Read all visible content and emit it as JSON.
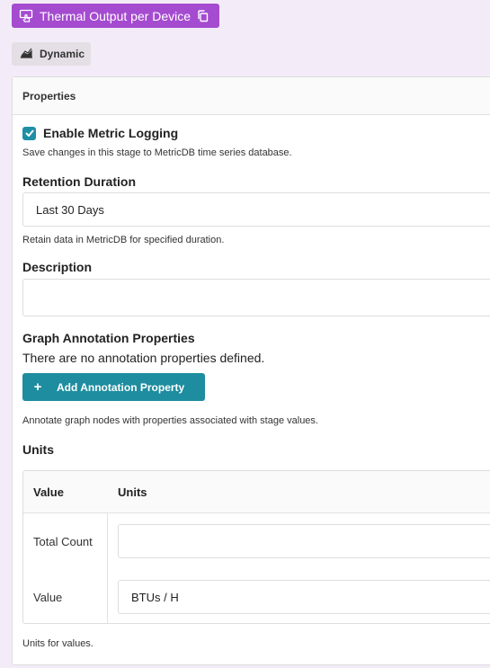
{
  "header": {
    "title": "Thermal Output per Device",
    "mode_label": "Dynamic"
  },
  "panel": {
    "title": "Properties",
    "metric_logging": {
      "label": "Enable Metric Logging",
      "checked": true,
      "help": "Save changes in this stage to MetricDB time series database."
    },
    "retention": {
      "label": "Retention Duration",
      "value": "Last 30 Days",
      "help": "Retain data in MetricDB for specified duration."
    },
    "description": {
      "label": "Description",
      "value": ""
    },
    "annotations": {
      "label": "Graph Annotation Properties",
      "empty_text": "There are no annotation properties defined.",
      "add_button": "Add Annotation Property",
      "help": "Annotate graph nodes with properties associated with stage values."
    },
    "units": {
      "label": "Units",
      "columns": [
        "Value",
        "Units"
      ],
      "rows": [
        {
          "value": "Total Count",
          "units": ""
        },
        {
          "value": "Value",
          "units": "BTUs / H"
        }
      ],
      "help": "Units for values."
    }
  },
  "colors": {
    "title_chip": "#a54bd0",
    "accent": "#1d8d9f",
    "background": "#f3ecf8"
  }
}
